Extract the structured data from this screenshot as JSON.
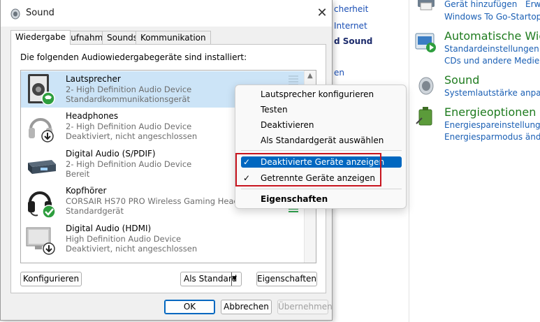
{
  "background_panel": {
    "left_fragments": [
      {
        "text": "cherheit",
        "bold": false
      },
      {
        "text": "Internet",
        "bold": false
      },
      {
        "text": "d Sound",
        "bold": true
      },
      {
        "text": "en",
        "bold": false
      }
    ],
    "sections": [
      {
        "heading": "",
        "links": [
          "Gerät hinzufügen",
          "Erwe",
          "Windows To Go-Startoptio"
        ],
        "icon": "device-printer-icon"
      },
      {
        "heading": "Automatische Wiede",
        "links": [
          "Standardeinstellungen fur",
          "CDs und andere Medien a"
        ],
        "icon": "autoplay-icon"
      },
      {
        "heading": "Sound",
        "links": [
          "Systemlautstärke anpasser"
        ],
        "icon": "speaker-icon"
      },
      {
        "heading": "Energieoptionen",
        "links": [
          "Energiespareinstellungen a",
          "Energiesparmodus ändern"
        ],
        "icon": "battery-power-icon"
      }
    ]
  },
  "dialog": {
    "title": "Sound",
    "close_glyph": "✕",
    "tabs": [
      "Wiedergabe",
      "Aufnahme",
      "Sounds",
      "Kommunikation"
    ],
    "caption": "Die folgenden Audiowiedergabegeräte sind installiert:",
    "devices": [
      {
        "name": "Lautsprecher",
        "line1": "2- High Definition Audio Device",
        "line2": "Standardkommunikationsgerät",
        "selected": true,
        "status": "phone"
      },
      {
        "name": "Headphones",
        "line1": "2- High Definition Audio Device",
        "line2": "Deaktiviert, nicht angeschlossen",
        "selected": false,
        "status": "down"
      },
      {
        "name": "Digital Audio (S/PDIF)",
        "line1": "2- High Definition Audio Device",
        "line2": "Bereit",
        "selected": false,
        "status": "none"
      },
      {
        "name": "Kopfhörer",
        "line1": "CORSAIR HS70 PRO Wireless Gaming Headset",
        "line2": "Standardgerät",
        "selected": false,
        "status": "check"
      },
      {
        "name": "Digital Audio (HDMI)",
        "line1": "High Definition Audio Device",
        "line2": "Deaktiviert, nicht angeschlossen",
        "selected": false,
        "status": "down"
      }
    ],
    "buttons": {
      "configure": "Konfigurieren",
      "set_default": "Als Standard",
      "properties": "Eigenschaften",
      "ok": "OK",
      "cancel": "Abbrechen",
      "apply": "Übernehmen"
    }
  },
  "context_menu": {
    "items": [
      {
        "label": "Lautsprecher konfigurieren"
      },
      {
        "label": "Testen"
      },
      {
        "label": "Deaktivieren"
      },
      {
        "label": "Als Standardgerät auswählen"
      }
    ],
    "checked_items": [
      {
        "label": "Deaktivierte Geräte anzeigen",
        "checked": true,
        "highlighted": true
      },
      {
        "label": "Getrennte Geräte anzeigen",
        "checked": true,
        "highlighted": false
      }
    ],
    "properties_label": "Eigenschaften",
    "check_glyph": "✓"
  },
  "colors": {
    "accent": "#0067c0",
    "selection": "#cce4f7",
    "highlight_box": "#c8141e",
    "cp_heading": "#1e7b1e",
    "cp_link": "#1a5fb4"
  }
}
